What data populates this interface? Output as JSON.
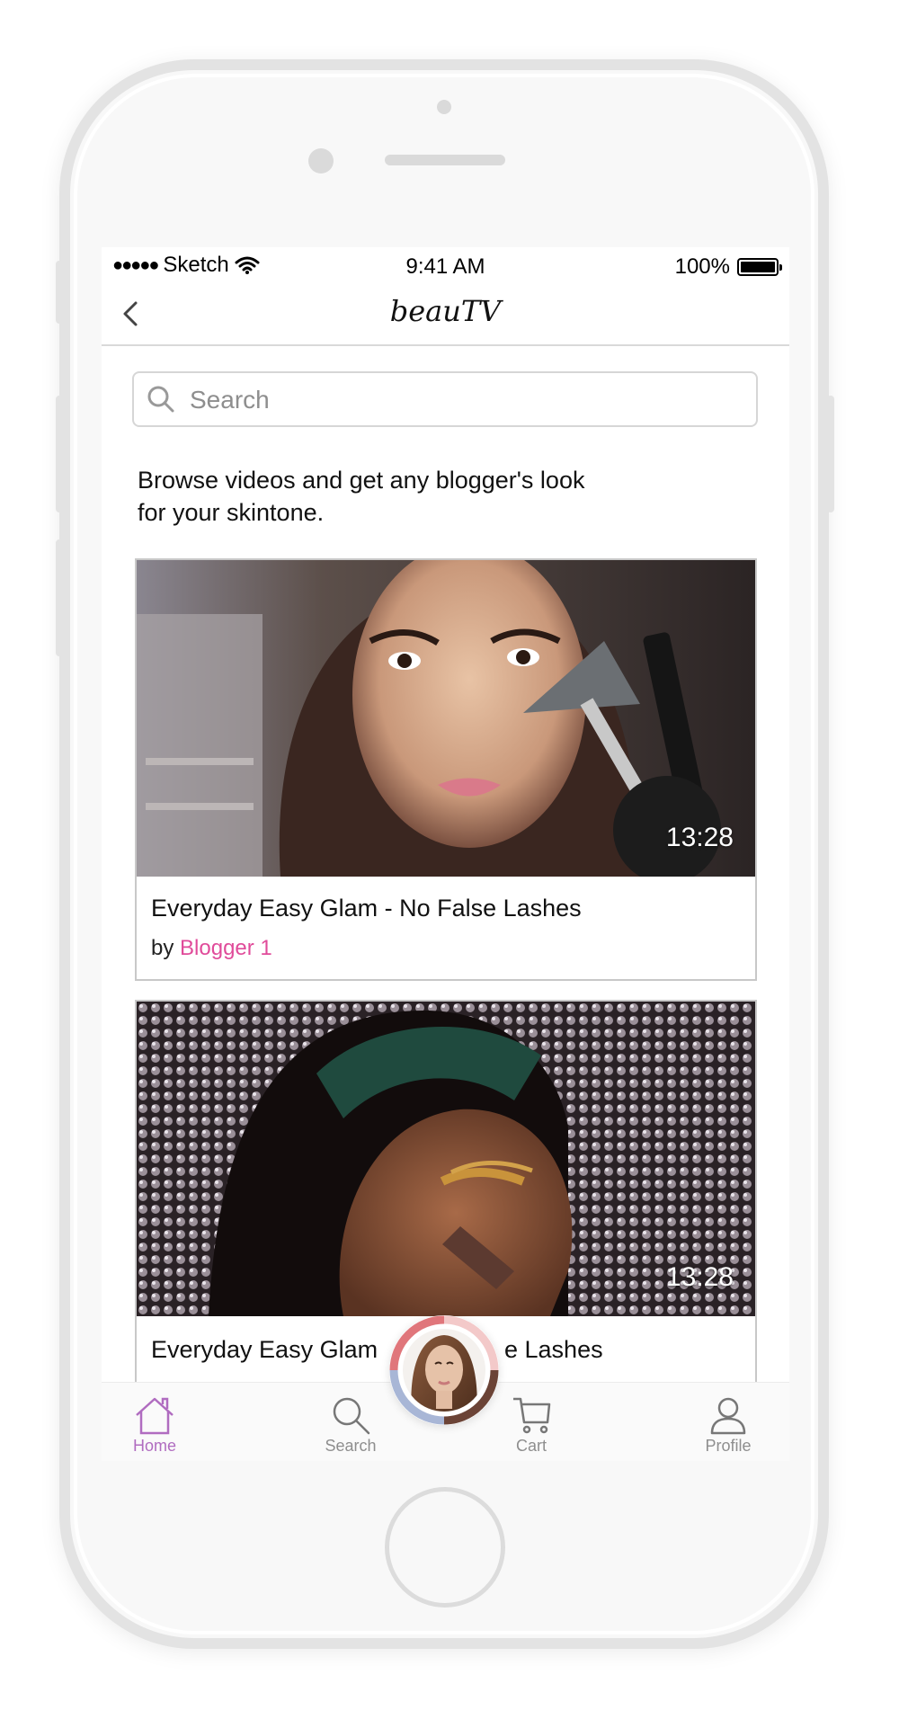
{
  "status_bar": {
    "signal": "●●●●●",
    "carrier": "Sketch",
    "time": "9:41 AM",
    "battery": "100%"
  },
  "nav": {
    "title": "beauTV",
    "back_icon": "chevron-left-icon"
  },
  "search": {
    "placeholder": "Search",
    "icon": "search-icon"
  },
  "intro": {
    "line1": "Browse videos and get any blogger's look",
    "line2": "for your skintone."
  },
  "videos": [
    {
      "title": "Everyday Easy Glam - No False Lashes",
      "by_label": "by",
      "blogger": "Blogger 1",
      "duration": "13:28"
    },
    {
      "title_left": "Everyday Easy Glam",
      "title_right": "e Lashes",
      "duration": "13:28"
    }
  ],
  "tab_bar": {
    "items": [
      {
        "label": "Home",
        "icon": "home-icon",
        "active": true
      },
      {
        "label": "Search",
        "icon": "search-icon",
        "active": false
      },
      {
        "label": "Cart",
        "icon": "cart-icon",
        "active": false
      },
      {
        "label": "Profile",
        "icon": "profile-icon",
        "active": false
      }
    ]
  },
  "colors": {
    "accent_pink": "#e04b9a",
    "active_tab": "#b06cc0",
    "skin_ring": [
      "#e0767b",
      "#f3c9c9",
      "#6b4336",
      "#a8b6d6"
    ]
  }
}
